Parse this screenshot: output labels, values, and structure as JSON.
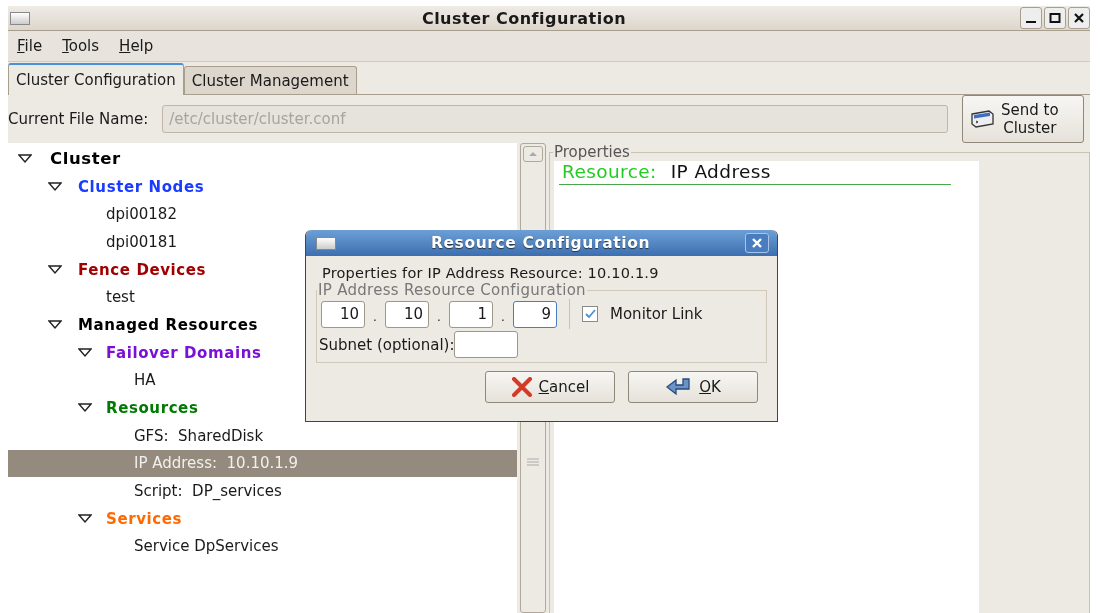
{
  "window": {
    "title": "Cluster Configuration"
  },
  "menu": [
    "File",
    "Tools",
    "Help"
  ],
  "tabs": [
    {
      "label": "Cluster Configuration",
      "selected": true
    },
    {
      "label": "Cluster Management",
      "selected": false
    }
  ],
  "file_name": {
    "label": "Current File Name:",
    "value": "/etc/cluster/cluster.conf",
    "disabled": true
  },
  "send_button": {
    "label": [
      "Send to",
      "Cluster"
    ]
  },
  "tree": [
    {
      "label": "Cluster",
      "color": "#000000",
      "expanded": true,
      "selected": false,
      "children": [
        {
          "label": "Cluster Nodes",
          "color": "#1a3cff",
          "expanded": true,
          "selected": false,
          "children": [
            {
              "label": "dpi00182",
              "selected": false
            },
            {
              "label": "dpi00181",
              "selected": false
            }
          ]
        },
        {
          "label": "Fence Devices",
          "color": "#a00000",
          "expanded": true,
          "selected": false,
          "children": [
            {
              "label": "test",
              "selected": false
            }
          ]
        },
        {
          "label": "Managed Resources",
          "color": "#000000",
          "expanded": true,
          "selected": false,
          "children": [
            {
              "label": "Failover Domains",
              "color": "#7a10d8",
              "expanded": true,
              "selected": false,
              "children": [
                {
                  "label": "HA",
                  "selected": false
                }
              ]
            },
            {
              "label": "Resources",
              "color": "#007a00",
              "expanded": true,
              "selected": false,
              "children": [
                {
                  "label": "GFS:  SharedDisk",
                  "selected": false
                },
                {
                  "label": "IP Address:  10.10.1.9",
                  "selected": true
                },
                {
                  "label": "Script:  DP_services",
                  "selected": false
                }
              ]
            },
            {
              "label": "Services",
              "color": "#ff6a00",
              "expanded": true,
              "selected": false,
              "children": [
                {
                  "label": "Service DpServices",
                  "selected": false
                }
              ]
            }
          ]
        }
      ]
    }
  ],
  "properties": {
    "legend": "Properties",
    "key": "Resource:",
    "value": "IP Address"
  },
  "dialog": {
    "title": "Resource Configuration",
    "heading": "Properties for IP Address Resource: 10.10.1.9",
    "group": "IP Address Resource Configuration",
    "octets": [
      {
        "value": "10",
        "focused": false
      },
      {
        "value": "10",
        "focused": false
      },
      {
        "value": "1",
        "focused": false
      },
      {
        "value": "9",
        "focused": true
      }
    ],
    "separators": [
      ".",
      ".",
      "."
    ],
    "monitor_link": {
      "label": "Monitor Link",
      "checked": true
    },
    "subnet": {
      "label": "Subnet (optional):"
    },
    "buttons": [
      {
        "label": "Cancel",
        "kind": "cancel"
      },
      {
        "label": "OK",
        "kind": "ok"
      }
    ]
  }
}
